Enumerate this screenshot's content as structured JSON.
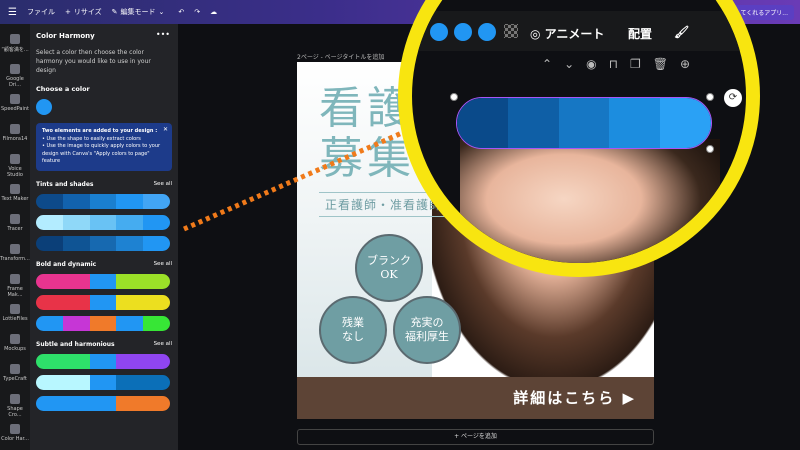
{
  "topbar": {
    "menu_icon": "hamburger-icon",
    "file": "ファイル",
    "resize": "リサイズ",
    "edit_mode": "編集モード",
    "right_button": "実してくれるアプリ..."
  },
  "rail": {
    "items": [
      "“顧客満を...",
      "Google Dri...",
      "SpeedPaint",
      "Filmora14",
      "Voice Studio",
      "Text Maker",
      "Tracer",
      "Transform...",
      "Frame Mak...",
      "LottieFiles",
      "Mockups",
      "TypeCraft",
      "Shape Cro...",
      "Color Har..."
    ]
  },
  "panel": {
    "title": "Color Harmony",
    "more": "•••",
    "description": "Select a color then choose the color harmony you would like to use in your design",
    "choose_color": "Choose a color",
    "selected_color": "#2196f3",
    "info_title": "Two elements are added to your design :",
    "info_line1": "• Use the shape to easily extract colors",
    "info_line2": "• Use the image to quickly apply colors to your design with Canva's \"Apply colors to page\" feature",
    "info_close": "✕",
    "sections": [
      {
        "title": "Tints and shades",
        "see_all": "See all",
        "bars": [
          [
            "#0d4a8a",
            "#1262ad",
            "#1a7fd0",
            "#2196f3",
            "#42a5f5"
          ],
          [
            "#b3ecff",
            "#8fd8f8",
            "#69c2f4",
            "#45acf0",
            "#2196f3"
          ],
          [
            "#0b3f78",
            "#0f5494",
            "#1769b0",
            "#1e82d2",
            "#2196f3"
          ]
        ]
      },
      {
        "title": "Bold and dynamic",
        "see_all": "See all",
        "bars": [
          [
            "#e8348f",
            "#e8348f",
            "#2196f3",
            "#9be028",
            "#9be028"
          ],
          [
            "#e83348",
            "#e83348",
            "#2196f3",
            "#ecdf1f",
            "#ecdf1f"
          ],
          [
            "#2196f3",
            "#c636d6",
            "#f07a2a",
            "#2196f3",
            "#37e636"
          ]
        ]
      },
      {
        "title": "Subtle and harmonious",
        "see_all": "See all",
        "bars": [
          [
            "#2ee06a",
            "#2ee06a",
            "#2196f3",
            "#8f45f0",
            "#8f45f0"
          ],
          [
            "#b8f7ff",
            "#b8f7ff",
            "#2196f3",
            "#0b6fb8",
            "#0b6fb8"
          ],
          [
            "#2196f3",
            "#2196f3",
            "#2196f3",
            "#f07a2a",
            "#f07a2a"
          ]
        ]
      }
    ]
  },
  "canvas": {
    "page_label": "2ページ - ページタイトルを追加",
    "heading_line1": "看護",
    "heading_line2": "募集",
    "subheading": "正看護師・准看護師",
    "circles": [
      {
        "line1": "ブランク",
        "line2": "OK"
      },
      {
        "line1": "残業",
        "line2": "なし"
      },
      {
        "line1": "充実の",
        "line2": "福利厚生"
      }
    ],
    "cta": "詳細はこちら ▶",
    "add_page": "+ ページを追加"
  },
  "zoom": {
    "animate": "アニメート",
    "arrange": "配置",
    "pill_colors": [
      "#0a4a8a",
      "#0f5fa6",
      "#1677c4",
      "#1c8ddf",
      "#2aa1f5"
    ]
  }
}
